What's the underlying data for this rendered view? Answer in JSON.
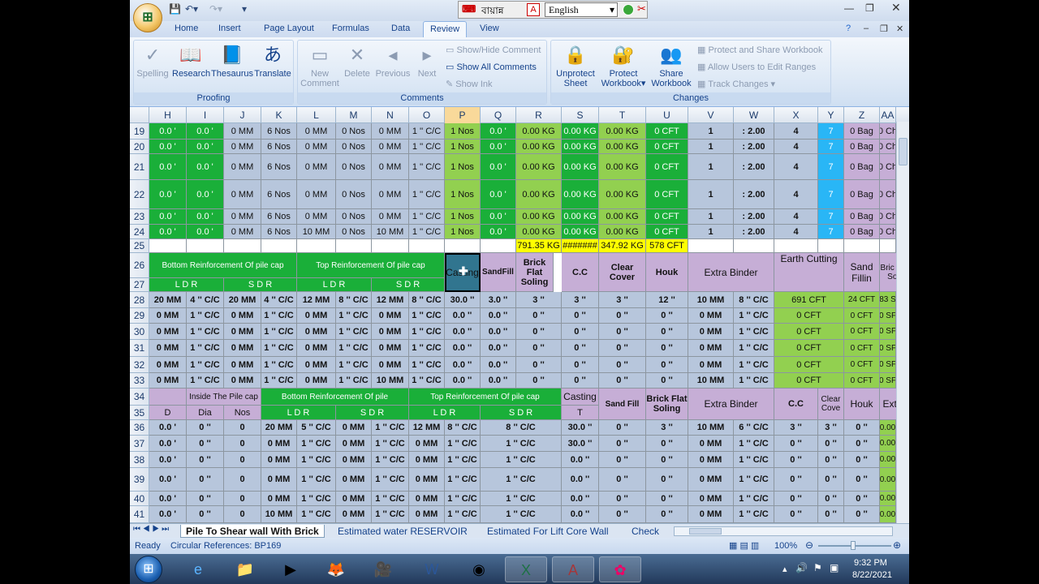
{
  "titlebar": {
    "lang_label": "বায়ান্ন",
    "lang_value": "English"
  },
  "tabs": [
    "Home",
    "Insert",
    "Page Layout",
    "Formulas",
    "Data",
    "Review",
    "View"
  ],
  "ribbon": {
    "proofing": {
      "label": "Proofing",
      "spelling": "Spelling",
      "research": "Research",
      "thesaurus": "Thesaurus",
      "translate": "Translate"
    },
    "comments": {
      "label": "Comments",
      "new1": "New",
      "new2": "Comment",
      "delete": "Delete",
      "previous": "Previous",
      "next": "Next",
      "show_hide": "Show/Hide Comment",
      "show_all": "Show All Comments",
      "show_ink": "Show Ink"
    },
    "changes": {
      "label": "Changes",
      "unprotect1": "Unprotect",
      "unprotect2": "Sheet",
      "protect1": "Protect",
      "protect2": "Workbook",
      "share1": "Share",
      "share2": "Workbook",
      "protect_share": "Protect and Share Workbook",
      "allow_users": "Allow Users to Edit Ranges",
      "track": "Track Changes"
    }
  },
  "columns": [
    "H",
    "I",
    "J",
    "K",
    "L",
    "M",
    "N",
    "O",
    "P",
    "Q",
    "R",
    "S",
    "T",
    "U",
    "V",
    "W",
    "X",
    "Y",
    "Z",
    "AA"
  ],
  "rows": [
    "19",
    "20",
    "21",
    "22",
    "23",
    "24",
    "25",
    "26",
    "27",
    "28",
    "29",
    "30",
    "31",
    "32",
    "33",
    "34",
    "35",
    "36",
    "37",
    "38",
    "39",
    "40",
    "41"
  ],
  "cells": {
    "r19": [
      "0.0 '",
      "0.0 '",
      "0 MM",
      "6 Nos",
      "0 MM",
      "0 Nos",
      "0 MM",
      "1 '' C/C",
      "1 Nos",
      "0.0 '",
      "0.00 KG",
      "0.00 KG",
      "0.00 KG",
      "0 CFT",
      "1",
      ": 2.00",
      "4",
      "7",
      "0 Bag",
      "0 Ch"
    ],
    "r20": [
      "0.0 '",
      "0.0 '",
      "0 MM",
      "6 Nos",
      "0 MM",
      "0 Nos",
      "0 MM",
      "1 '' C/C",
      "1 Nos",
      "0.0 '",
      "0.00 KG",
      "0.00 KG",
      "0.00 KG",
      "0 CFT",
      "1",
      ": 2.00",
      "4",
      "7",
      "0 Bag",
      "0 Ch"
    ],
    "r21": [
      "0.0 '",
      "0.0 '",
      "0 MM",
      "6 Nos",
      "0 MM",
      "0 Nos",
      "0 MM",
      "1 '' C/C",
      "1 Nos",
      "0.0 '",
      "0.00 KG",
      "0.00 KG",
      "0.00 KG",
      "0 CFT",
      "1",
      ": 2.00",
      "4",
      "7",
      "0 Bag",
      "0 Ch"
    ],
    "r22": [
      "0.0 '",
      "0.0 '",
      "0 MM",
      "6 Nos",
      "0 MM",
      "0 Nos",
      "0 MM",
      "1 '' C/C",
      "1 Nos",
      "0.0 '",
      "0.00 KG",
      "0.00 KG",
      "0.00 KG",
      "0 CFT",
      "1",
      ": 2.00",
      "4",
      "7",
      "0 Bag",
      "0 Ch"
    ],
    "r23": [
      "0.0 '",
      "0.0 '",
      "0 MM",
      "6 Nos",
      "0 MM",
      "0 Nos",
      "0 MM",
      "1 '' C/C",
      "1 Nos",
      "0.0 '",
      "0.00 KG",
      "0.00 KG",
      "0.00 KG",
      "0 CFT",
      "1",
      ": 2.00",
      "4",
      "7",
      "0 Bag",
      "0 Ch"
    ],
    "r24": [
      "0.0 '",
      "0.0 '",
      "0 MM",
      "6 Nos",
      "10 MM",
      "0 Nos",
      "10 MM",
      "1 '' C/C",
      "1 Nos",
      "0.0 '",
      "0.00 KG",
      "0.00 KG",
      "0.00 KG",
      "0 CFT",
      "1",
      ": 2.00",
      "4",
      "7",
      "0 Bag",
      "0 Ch"
    ],
    "r25": {
      "R": "791.35 KG",
      "S": "#######",
      "T": "347.92 KG",
      "U": "578 CFT"
    },
    "hdr26": {
      "bottom": "Bottom Reinforcement  Of pile cap",
      "top": "Top   Reinforcement  Of pile cap",
      "casting": "Casting",
      "sandfill": "SandFill",
      "brickflat": "Brick Flat Soling",
      "cc": "C.C",
      "clearcover": "Clear Cover",
      "houk": "Houk",
      "extra_binder": "Extra Binder",
      "earth": "Earth Cutting",
      "sandfilling": "Sand Fillin",
      "brickfal": "Bric Fal Soli"
    },
    "hdr27": {
      "ldr1": "L D  R",
      "sdr1": "S D R",
      "ldr2": "L D  R",
      "sdr2": "S D R"
    },
    "r28": [
      "20 MM",
      "4 '' C/C",
      "20 MM",
      "4 '' C/C",
      "12 MM",
      "8 '' C/C",
      "12 MM",
      "8 '' C/C",
      "30.0 ''",
      "3.0 ''",
      "3 ''",
      "3 ''",
      "3 ''",
      "12 ''",
      "10 MM",
      "8 '' C/C",
      "691 CFT",
      "24 CFT",
      "83 S"
    ],
    "r29": [
      "0 MM",
      "1 '' C/C",
      "0 MM",
      "1 '' C/C",
      "0 MM",
      "1 '' C/C",
      "0 MM",
      "1 '' C/C",
      "0.0 ''",
      "0.0 ''",
      "0 ''",
      "0 ''",
      "0 ''",
      "0 ''",
      "0 MM",
      "1 '' C/C",
      "0 CFT",
      "0 CFT",
      "0 SF"
    ],
    "r30": [
      "0 MM",
      "1 '' C/C",
      "0 MM",
      "1 '' C/C",
      "0 MM",
      "1 '' C/C",
      "0 MM",
      "1 '' C/C",
      "0.0 ''",
      "0.0 ''",
      "0 ''",
      "0 ''",
      "0 ''",
      "0 ''",
      "0 MM",
      "1 '' C/C",
      "0 CFT",
      "0 CFT",
      "0 SF"
    ],
    "r31": [
      "0 MM",
      "1 '' C/C",
      "0 MM",
      "1 '' C/C",
      "0 MM",
      "1 '' C/C",
      "0 MM",
      "1 '' C/C",
      "0.0 ''",
      "0.0 ''",
      "0 ''",
      "0 ''",
      "0 ''",
      "0 ''",
      "0 MM",
      "1 '' C/C",
      "0 CFT",
      "0 CFT",
      "0 SF"
    ],
    "r32": [
      "0 MM",
      "1 '' C/C",
      "0 MM",
      "1 '' C/C",
      "0 MM",
      "1 '' C/C",
      "0 MM",
      "1 '' C/C",
      "0.0 ''",
      "0.0 ''",
      "0 ''",
      "0 ''",
      "0 ''",
      "0 ''",
      "0 MM",
      "1 '' C/C",
      "0 CFT",
      "0 CFT",
      "0 SF"
    ],
    "r33": [
      "0 MM",
      "1 '' C/C",
      "0 MM",
      "1 '' C/C",
      "0 MM",
      "1 '' C/C",
      "10 MM",
      "1 '' C/C",
      "0.0 ''",
      "0.0 ''",
      "0 ''",
      "0 ''",
      "0 ''",
      "0 ''",
      "10 MM",
      "1 '' C/C",
      "0 CFT",
      "0 CFT",
      "0 SF"
    ],
    "hdr34": {
      "inside": "Inside The Pile cap",
      "bottom": "Bottom Reinforcement  Of pile",
      "top": "Top   Reinforcement  Of pile cap",
      "casting": "Casting",
      "sandfill": "Sand Fill",
      "brickflat": "Brick Flat Soling",
      "extra_binder": "Extra Binder",
      "cc": "C.C",
      "clearcove": "Clear Cove",
      "houk": "Houk",
      "extra": "Extra"
    },
    "hdr35": {
      "d": "D",
      "dia": "Dia",
      "nos": "Nos",
      "ldr1": "L D  R",
      "sdr1": "S D R",
      "ldr2": "L D  R",
      "sdr2": "S D R",
      "t": "T"
    },
    "r36": [
      "0.0 '",
      "0 ''",
      "0",
      "20 MM",
      "5 '' C/C",
      "0 MM",
      "1 '' C/C",
      "12 MM",
      "8 '' C/C",
      "8 '' C/C",
      "30.0 ''",
      "0 ''",
      "3 ''",
      "10 MM",
      "6 '' C/C",
      "3 ''",
      "3 ''",
      "0 ''",
      "0.00"
    ],
    "r37": [
      "0.0 '",
      "0 ''",
      "0",
      "0 MM",
      "1 '' C/C",
      "0 MM",
      "1 '' C/C",
      "0 MM",
      "1 '' C/C",
      "1 '' C/C",
      "30.0 ''",
      "0 ''",
      "0 ''",
      "0 MM",
      "1 '' C/C",
      "0 ''",
      "0 ''",
      "0 ''",
      "0.00"
    ],
    "r38": [
      "0.0 '",
      "0 ''",
      "0",
      "0 MM",
      "1 '' C/C",
      "0 MM",
      "1 '' C/C",
      "0 MM",
      "1 '' C/C",
      "1 '' C/C",
      "0.0 ''",
      "0 ''",
      "0 ''",
      "0 MM",
      "1 '' C/C",
      "0 ''",
      "0 ''",
      "0 ''",
      "0.00"
    ],
    "r39": [
      "0.0 '",
      "0 ''",
      "0",
      "0 MM",
      "1 '' C/C",
      "0 MM",
      "1 '' C/C",
      "0 MM",
      "1 '' C/C",
      "1 '' C/C",
      "0.0 ''",
      "0 ''",
      "0 ''",
      "0 MM",
      "1 '' C/C",
      "0 ''",
      "0 ''",
      "0 ''",
      "0.00"
    ],
    "r40": [
      "0.0 '",
      "0 ''",
      "0",
      "0 MM",
      "1 '' C/C",
      "0 MM",
      "1 '' C/C",
      "0 MM",
      "1 '' C/C",
      "1 '' C/C",
      "0.0 ''",
      "0 ''",
      "0 ''",
      "0 MM",
      "1 '' C/C",
      "0 ''",
      "0 ''",
      "0 ''",
      "0.00"
    ],
    "r41": [
      "0.0 '",
      "0 ''",
      "0",
      "10 MM",
      "1 '' C/C",
      "0 MM",
      "1 '' C/C",
      "0 MM",
      "1 '' C/C",
      "1 '' C/C",
      "0.0 ''",
      "0 ''",
      "0 ''",
      "0 MM",
      "1 '' C/C",
      "0 ''",
      "0 ''",
      "0 ''",
      "0.00"
    ]
  },
  "sheets": [
    "Pile To Shear wall With Brick",
    "Estimated water RESERVOIR",
    "Estimated For Lift  Core  Wall",
    "Check"
  ],
  "status": {
    "ready": "Ready",
    "circular": "Circular References: BP169",
    "zoom": "100%"
  },
  "clock": {
    "time": "9:32 PM",
    "date": "8/22/2021"
  }
}
